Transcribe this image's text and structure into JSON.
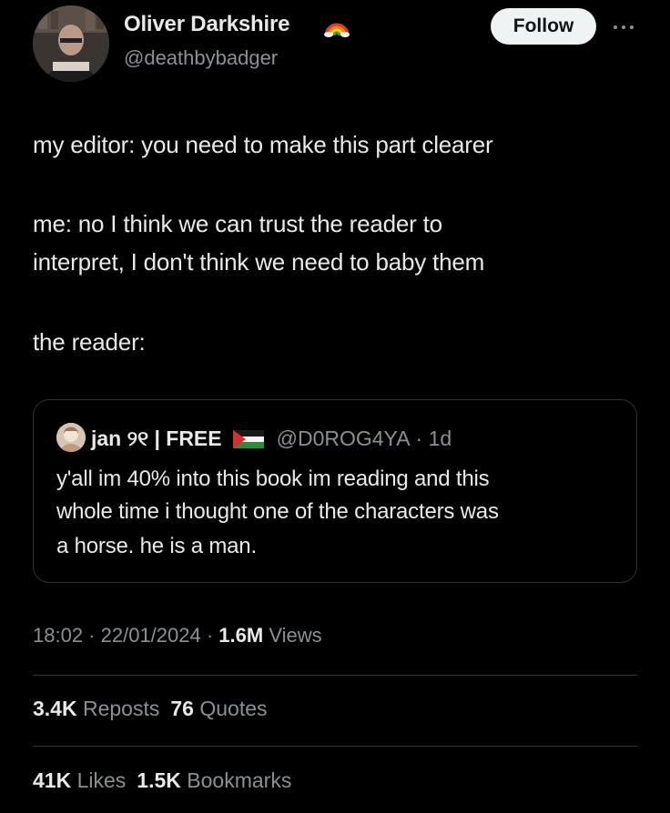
{
  "author": {
    "display_name": "Oliver Darkshire",
    "handle": "@deathbybadger",
    "avatar_icon": "user-avatar-photo",
    "badge_icon": "rainbow-icon"
  },
  "actions": {
    "follow_label": "Follow",
    "more_icon": "more-horizontal-icon"
  },
  "tweet": {
    "lines": [
      "my editor: you need to make this part clearer",
      "me: no I think we can trust the reader to",
      "interpret, I don't think we need to baby them",
      "the reader:"
    ]
  },
  "quoted_tweet": {
    "name": "jan ୨୧ | FREE",
    "flag_icon": "palestine-flag-icon",
    "handle": "@D0ROG4YA",
    "time": "· 1d",
    "lines": [
      "y'all im 40% into this book im reading and this",
      "whole time i thought one of the characters was",
      "a horse. he is a man."
    ]
  },
  "meta": {
    "time": "18:02",
    "sep1": " · ",
    "date": "22/01/2024",
    "sep2": " · ",
    "views_count": "1.6M",
    "views_label": " Views"
  },
  "stats": {
    "reposts_count": "3.4K",
    "reposts_label": "Reposts",
    "quotes_count": "76",
    "quotes_label": "Quotes",
    "likes_count": "41K",
    "likes_label": "Likes",
    "bookmarks_count": "1.5K",
    "bookmarks_label": "Bookmarks"
  },
  "colors": {
    "background": "#000000",
    "text_primary": "#e7e9ea",
    "text_secondary": "#8b9095",
    "border": "#2f3336",
    "follow_bg": "#eff3f4"
  }
}
